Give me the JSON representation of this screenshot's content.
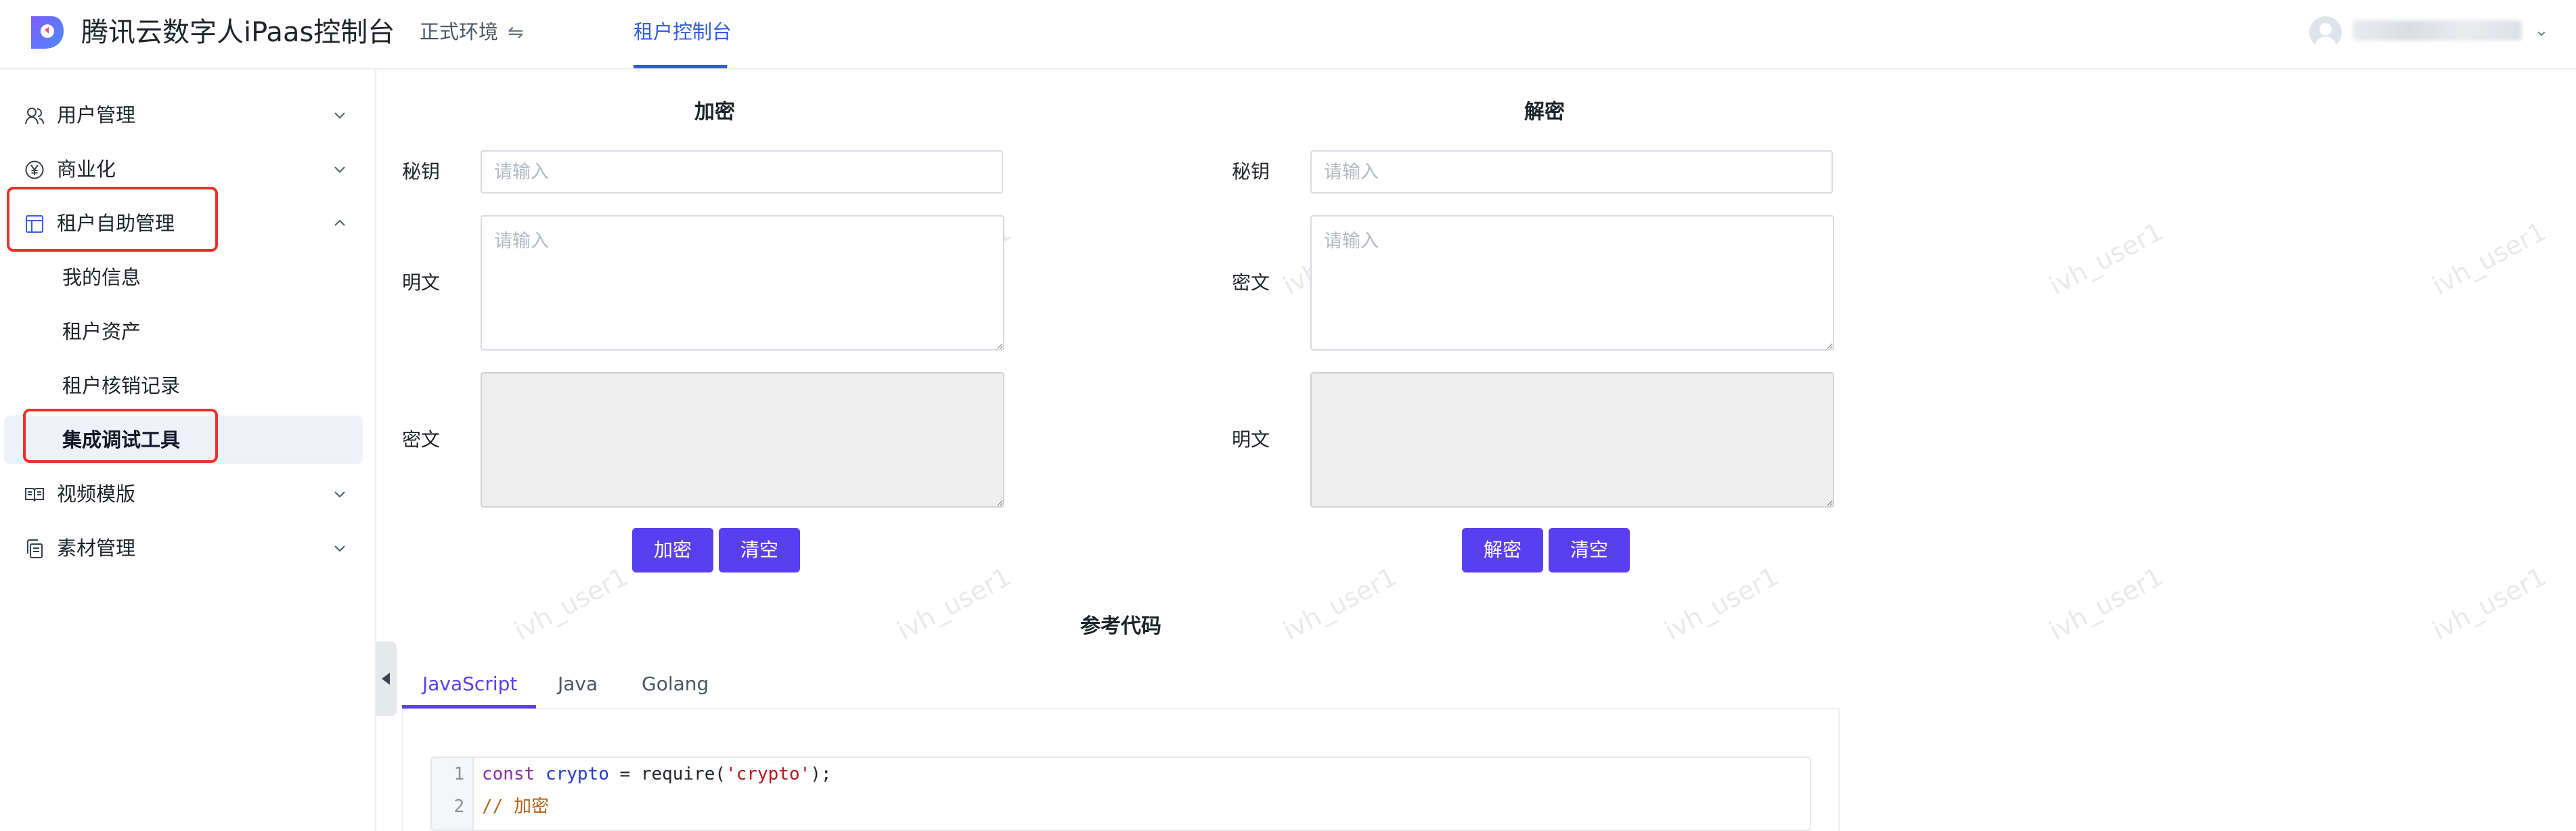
{
  "header": {
    "app_title": "腾讯云数字人iPaas控制台",
    "env_label": "正式环境",
    "env_swap_icon": "⇋",
    "active_tab": "租户控制台",
    "user_caret": "⌄",
    "brand_color": "#5a3ff0",
    "link_color": "#2f5de0"
  },
  "sidebar": {
    "menus": [
      {
        "label": "用户管理",
        "icon": "users-icon",
        "expanded": false
      },
      {
        "label": "商业化",
        "icon": "yen-circle-icon",
        "expanded": false
      },
      {
        "label": "租户自助管理",
        "icon": "layout-icon",
        "expanded": true
      },
      {
        "label": "视频模版",
        "icon": "book-open-icon",
        "expanded": false
      },
      {
        "label": "素材管理",
        "icon": "copy-icon",
        "expanded": false
      }
    ],
    "sub_items": [
      "我的信息",
      "租户资产",
      "租户核销记录",
      "集成调试工具"
    ],
    "active_sub_item": "集成调试工具",
    "highlight_color": "#e7312d"
  },
  "watermark": "ivh_user1",
  "encrypt": {
    "title": "加密",
    "key_label": "秘钥",
    "key_placeholder": "请输入",
    "input_label": "明文",
    "input_placeholder": "请输入",
    "output_label": "密文",
    "action_button": "加密",
    "clear_button": "清空"
  },
  "decrypt": {
    "title": "解密",
    "key_label": "秘钥",
    "key_placeholder": "请输入",
    "input_label": "密文",
    "input_placeholder": "请输入",
    "output_label": "明文",
    "action_button": "解密",
    "clear_button": "清空"
  },
  "code": {
    "title": "参考代码",
    "tabs": [
      "JavaScript",
      "Java",
      "Golang"
    ],
    "active_tab": "JavaScript",
    "lines": [
      {
        "num": "1",
        "kw": "const",
        "name": "crypto",
        "op": " = require(",
        "str": "'crypto'",
        "end": ");"
      },
      {
        "num": "2",
        "comment": "// 加密"
      }
    ]
  }
}
